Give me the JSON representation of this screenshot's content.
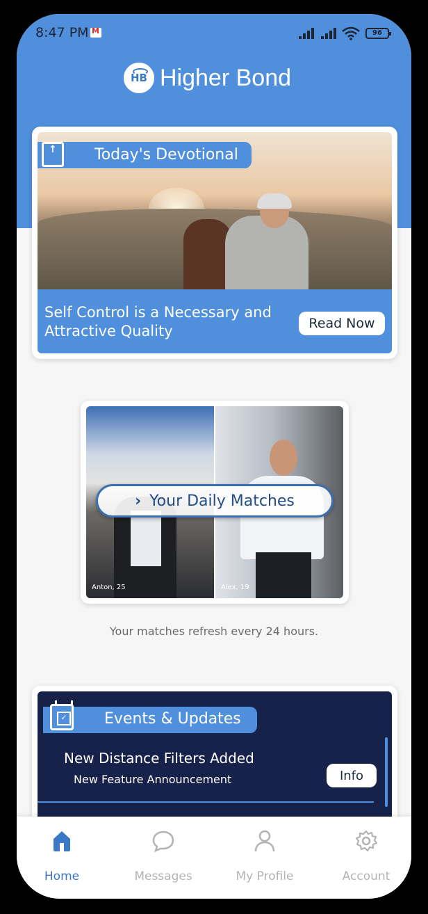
{
  "status_bar": {
    "time": "8:47 PM",
    "battery": "96",
    "icons": [
      "gmail-icon",
      "signal-icon",
      "signal-icon",
      "wifi-icon",
      "battery-icon"
    ]
  },
  "header": {
    "logo_badge": "HB",
    "app_name": "Higher Bond",
    "background_color": "#4f8fdb"
  },
  "devotional": {
    "tab_label": "Today's Devotional",
    "title": "Self Control is a Necessary and Attractive Quality",
    "button_label": "Read Now",
    "icon": "book-icon"
  },
  "daily_matches": {
    "button_label": "Your Daily Matches",
    "matches": [
      {
        "caption": "Anton, 25"
      },
      {
        "caption": "Alex, 19"
      }
    ],
    "refresh_note": "Your matches refresh every 24 hours."
  },
  "events": {
    "tab_label": "Events & Updates",
    "icon": "calendar-icon",
    "items": [
      {
        "title": "New Distance Filters Added",
        "subtitle": "New Feature Announcement",
        "button_label": "Info"
      }
    ],
    "background_color": "#16224a"
  },
  "bottom_nav": {
    "items": [
      {
        "label": "Home",
        "icon": "home-icon",
        "active": true
      },
      {
        "label": "Messages",
        "icon": "chat-bubble-icon",
        "active": false
      },
      {
        "label": "My Profile",
        "icon": "person-icon",
        "active": false
      },
      {
        "label": "Account",
        "icon": "gear-icon",
        "active": false
      }
    ],
    "active_color": "#3b78c6",
    "inactive_color": "#b3b3b3"
  }
}
